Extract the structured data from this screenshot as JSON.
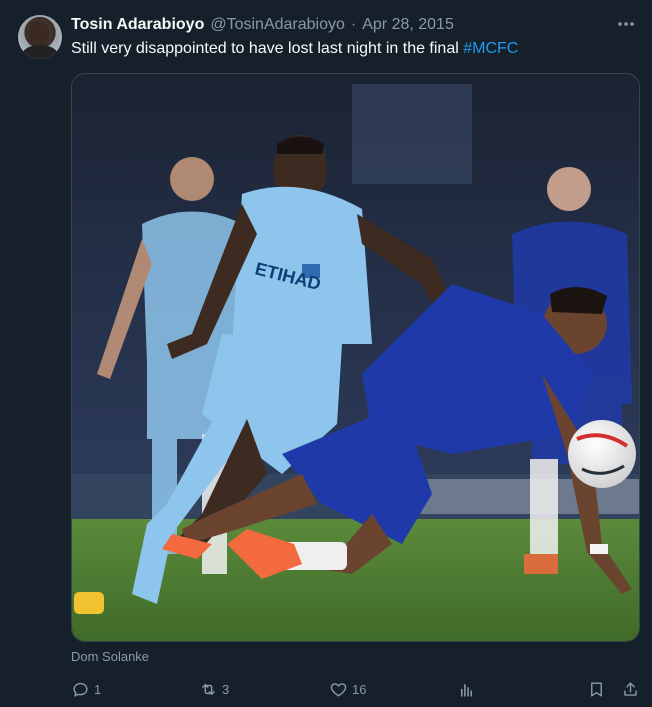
{
  "tweet": {
    "display_name": "Tosin Adarabioyo",
    "handle": "@TosinAdarabioyo",
    "separator": "·",
    "date": "Apr 28, 2015",
    "text": "Still very disappointed to have lost last night in the final ",
    "hashtag": "#MCFC",
    "media_caption": "Dom Solanke",
    "shirt_sponsor": "ETIHAD"
  },
  "actions": {
    "replies": "1",
    "retweets": "3",
    "likes": "16"
  },
  "colors": {
    "background": "#15202b",
    "accent": "#1d9bf0",
    "muted": "#8b98a5",
    "city_blue": "#8ec5ec",
    "chelsea_blue": "#1f3aa8",
    "pitch": "#4f7d35"
  },
  "icons": [
    "more-icon",
    "reply-icon",
    "retweet-icon",
    "like-icon",
    "views-icon",
    "bookmark-icon",
    "share-icon"
  ]
}
